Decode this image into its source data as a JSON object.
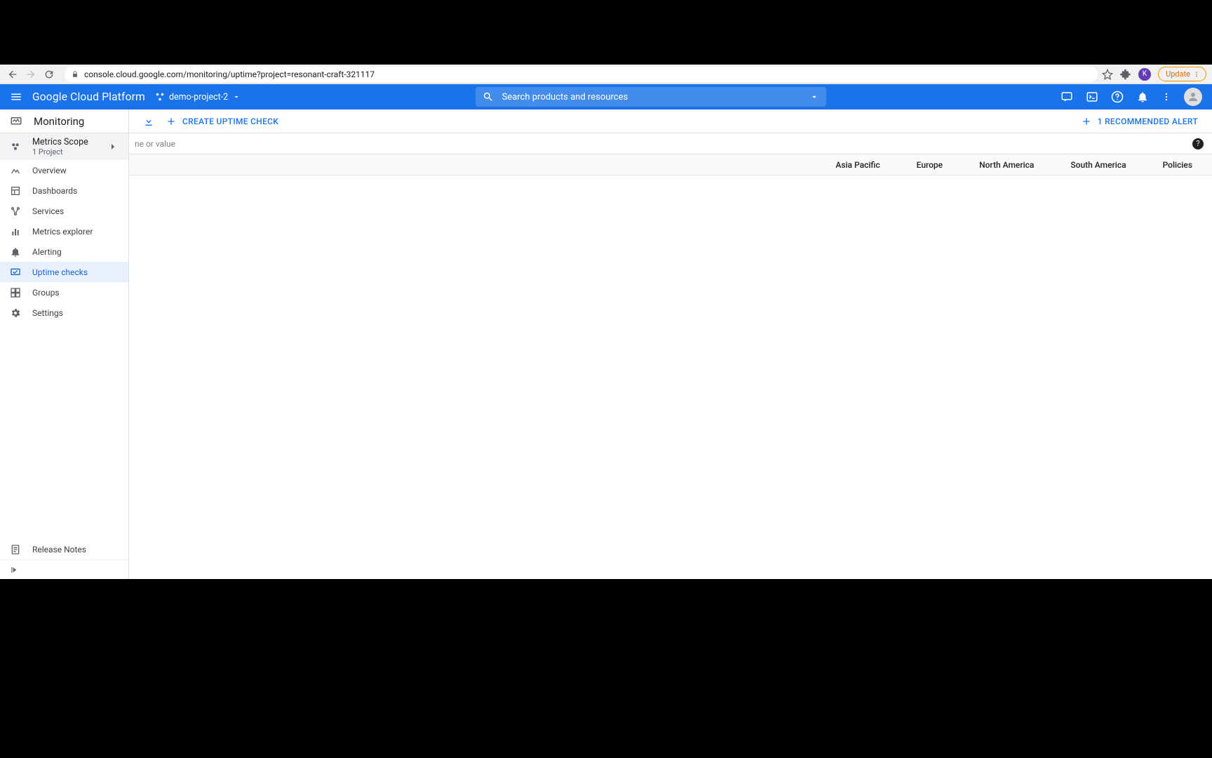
{
  "browser": {
    "url": "console.cloud.google.com/monitoring/uptime?project=resonant-craft-321117",
    "update_label": "Update",
    "avatar_letter": "K"
  },
  "gcp_header": {
    "logo": "Google Cloud Platform",
    "project": "demo-project-2",
    "search_placeholder": "Search products and resources"
  },
  "sidebar": {
    "title": "Monitoring",
    "scope": {
      "title": "Metrics Scope",
      "subtitle": "1 Project"
    },
    "items": [
      {
        "label": "Overview"
      },
      {
        "label": "Dashboards"
      },
      {
        "label": "Services"
      },
      {
        "label": "Metrics explorer"
      },
      {
        "label": "Alerting"
      },
      {
        "label": "Uptime checks"
      },
      {
        "label": "Groups"
      },
      {
        "label": "Settings"
      }
    ],
    "release_notes": "Release Notes"
  },
  "action_bar": {
    "create_label": "CREATE UPTIME CHECK",
    "recommended_label": "1 RECOMMENDED ALERT"
  },
  "filter": {
    "hint": "Enter property name or value"
  },
  "columns": [
    "Asia Pacific",
    "Europe",
    "North America",
    "South America",
    "Policies"
  ]
}
